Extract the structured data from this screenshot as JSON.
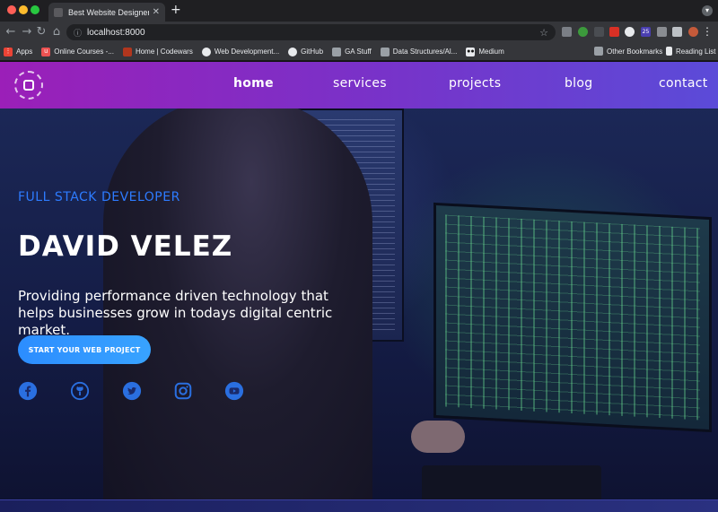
{
  "browser": {
    "tab_title": "Best Website Designers NYC |",
    "tab_close": "✕",
    "new_tab": "+",
    "url": "localhost:8000",
    "extension_badge": "25",
    "bookmarks": [
      {
        "label": "Apps",
        "icon": "apps-grid-icon",
        "color": "#ea4335"
      },
      {
        "label": "Online Courses -...",
        "icon": "udemy-icon",
        "color": "#ec5252"
      },
      {
        "label": "Home | Codewars",
        "icon": "codewars-icon",
        "color": "#b1361e"
      },
      {
        "label": "Web Development...",
        "icon": "webdev-icon",
        "color": "#e8eaed"
      },
      {
        "label": "GitHub",
        "icon": "github-icon",
        "color": "#e8eaed"
      },
      {
        "label": "GA Stuff",
        "icon": "folder-icon",
        "color": "#9aa0a6"
      },
      {
        "label": "Data Structures/Al...",
        "icon": "folder-icon",
        "color": "#9aa0a6"
      },
      {
        "label": "Medium",
        "icon": "medium-icon",
        "color": "#e8eaed"
      }
    ],
    "other_bookmarks": "Other Bookmarks",
    "reading_list": "Reading List"
  },
  "site": {
    "nav": {
      "links": [
        "home",
        "services",
        "projects",
        "blog",
        "contact"
      ]
    },
    "hero": {
      "role": "FULL STACK DEVELOPER",
      "name": "DAVID VELEZ",
      "tagline": "Providing performance driven technology that helps businesses grow in todays digital centric market.",
      "cta": "START YOUR WEB PROJECT",
      "social": [
        "facebook-icon",
        "github-icon",
        "twitter-icon",
        "instagram-icon",
        "youtube-icon"
      ]
    },
    "colors": {
      "nav_start": "#9b1fb8",
      "nav_end": "#5b4bd8",
      "accent_blue": "#2d7bff",
      "social_blue": "#2a6fe0"
    }
  }
}
